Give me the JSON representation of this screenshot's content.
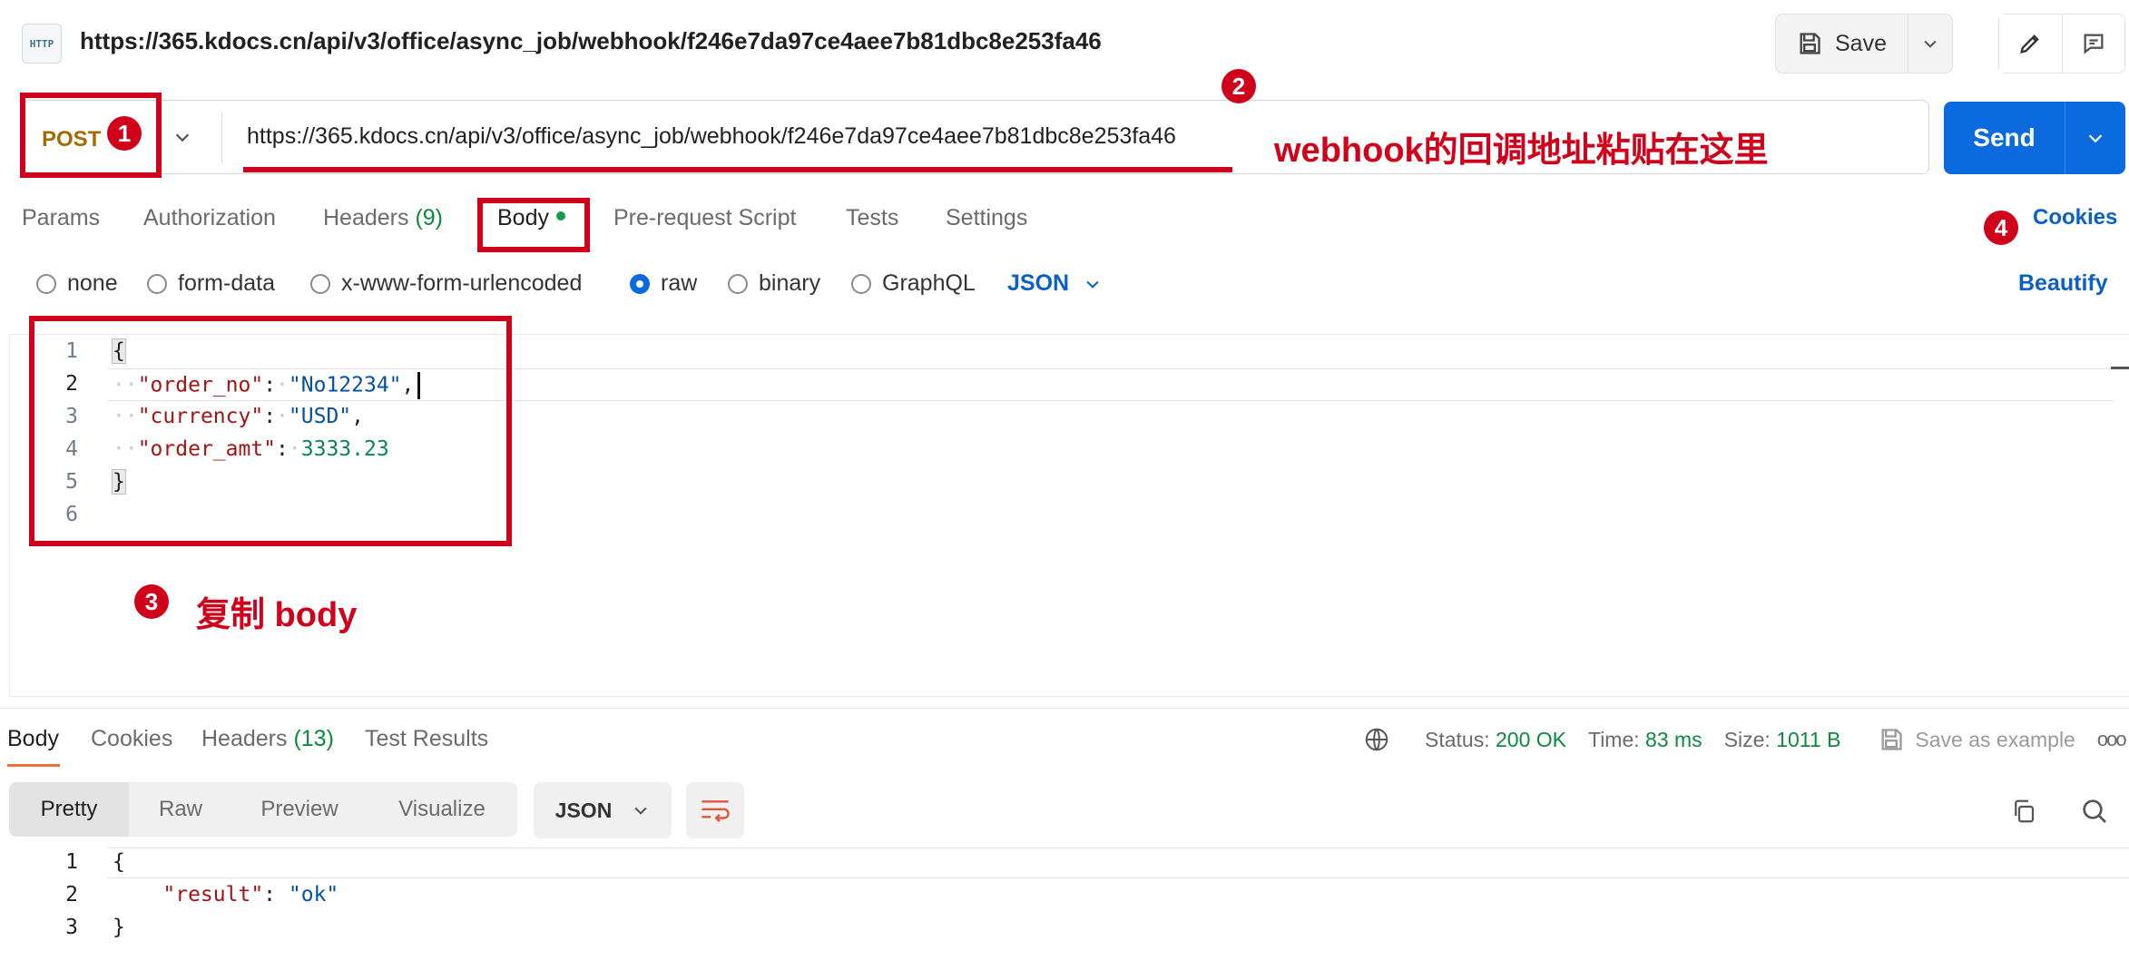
{
  "header": {
    "title_url": "https://365.kdocs.cn/api/v3/office/async_job/webhook/f246e7da97ce4aee7b81dbc8e253fa46",
    "http_icon_text": "HTTP",
    "save_label": "Save"
  },
  "request": {
    "method": "POST",
    "url": "https://365.kdocs.cn/api/v3/office/async_job/webhook/f246e7da97ce4aee7b81dbc8e253fa46",
    "send_label": "Send"
  },
  "tabs": [
    {
      "label": "Params"
    },
    {
      "label": "Authorization"
    },
    {
      "label": "Headers",
      "count": "(9)"
    },
    {
      "label": "Body"
    },
    {
      "label": "Pre-request Script"
    },
    {
      "label": "Tests"
    },
    {
      "label": "Settings"
    }
  ],
  "cookies_label": "Cookies",
  "body_modes": [
    "none",
    "form-data",
    "x-www-form-urlencoded",
    "raw",
    "binary",
    "GraphQL"
  ],
  "body_mode_selected": "raw",
  "body_format": "JSON",
  "beautify_label": "Beautify",
  "editor": {
    "line_numbers": [
      "1",
      "2",
      "3",
      "4",
      "5",
      "6"
    ],
    "open_brace": "{",
    "close_brace": "}",
    "fields": [
      {
        "key": "\"order_no\"",
        "value": "\"No12234\"",
        "trail": ","
      },
      {
        "key": "\"currency\"",
        "value": "\"USD\"",
        "trail": ","
      },
      {
        "key": "\"order_amt\"",
        "value": "3333.23",
        "trail": ""
      }
    ]
  },
  "annotations": {
    "badges": [
      "1",
      "2",
      "3",
      "4"
    ],
    "note_url": "webhook的回调地址粘贴在这里",
    "note_body": "复制 body",
    "color": "#d0021b"
  },
  "response": {
    "tabs": [
      {
        "label": "Body"
      },
      {
        "label": "Cookies"
      },
      {
        "label": "Headers",
        "count": "(13)"
      },
      {
        "label": "Test Results"
      }
    ],
    "status_label": "Status:",
    "status_value": "200 OK",
    "time_label": "Time:",
    "time_value": "83 ms",
    "size_label": "Size:",
    "size_value": "1011 B",
    "save_example_label": "Save as example",
    "more_label": "ooo",
    "view_modes": [
      "Pretty",
      "Raw",
      "Preview",
      "Visualize"
    ],
    "format": "JSON",
    "line_numbers": [
      "1",
      "2",
      "3"
    ],
    "open_brace": "{",
    "close_brace": "}",
    "key": "\"result\"",
    "value": "\"ok\""
  },
  "colors": {
    "accent_blue": "#0b6bde",
    "method_color": "#a56b00",
    "success_green": "#0d8a3f"
  }
}
